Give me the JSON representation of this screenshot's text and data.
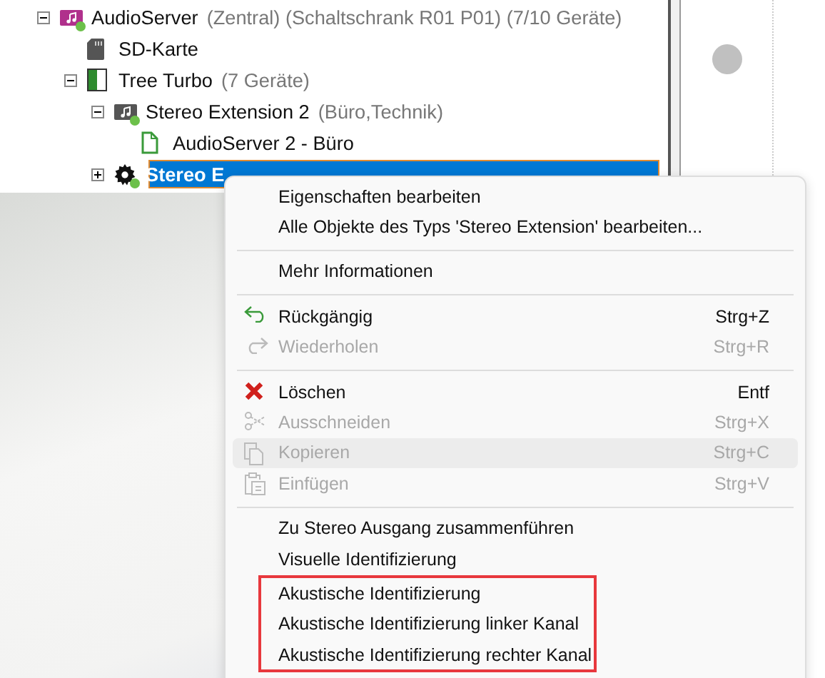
{
  "tree": [
    {
      "kind": "audioserver",
      "label": "AudioServer",
      "detail": "(Zentral) (Schaltschrank R01 P01)  (7/10 Geräte)",
      "expanded": true,
      "online": true,
      "selected": false,
      "children": [
        {
          "kind": "sdcard",
          "label": "SD-Karte",
          "online": false,
          "selected": false
        },
        {
          "kind": "treeturbo",
          "label": "Tree Turbo",
          "detail": "(7 Geräte)",
          "expanded": true,
          "online": false,
          "selected": false,
          "children": [
            {
              "kind": "extension",
              "label": "Stereo Extension 2",
              "detail": "(Büro,Technik)",
              "expanded": true,
              "online": true,
              "selected": false,
              "children": [
                {
                  "kind": "file",
                  "label": "AudioServer 2 - Büro",
                  "online": false,
                  "selected": false
                }
              ]
            },
            {
              "kind": "gear",
              "label": "Stereo E",
              "expanded": false,
              "online": true,
              "selected": true
            }
          ]
        }
      ]
    }
  ],
  "menu": [
    {
      "kind": "plain",
      "label": "Eigenschaften bearbeiten",
      "disabled": false,
      "hovered": false
    },
    {
      "kind": "plain",
      "label": "Alle Objekte des Typs 'Stereo Extension' bearbeiten...",
      "disabled": false,
      "hovered": false
    },
    {
      "kind": "separator"
    },
    {
      "kind": "plain",
      "label": "Mehr Informationen",
      "disabled": false,
      "hovered": false
    },
    {
      "kind": "separator"
    },
    {
      "kind": "undo",
      "label": "Rückgängig",
      "shortcut": "Strg+Z",
      "disabled": false,
      "hovered": false
    },
    {
      "kind": "redo",
      "label": "Wiederholen",
      "shortcut": "Strg+R",
      "disabled": true,
      "hovered": false
    },
    {
      "kind": "separator"
    },
    {
      "kind": "delete",
      "label": "Löschen",
      "shortcut": "Entf",
      "disabled": false,
      "hovered": false
    },
    {
      "kind": "cut",
      "label": "Ausschneiden",
      "shortcut": "Strg+X",
      "disabled": true,
      "hovered": false
    },
    {
      "kind": "copy",
      "label": "Kopieren",
      "shortcut": "Strg+C",
      "disabled": true,
      "hovered": true
    },
    {
      "kind": "paste",
      "label": "Einfügen",
      "shortcut": "Strg+V",
      "disabled": true,
      "hovered": false
    },
    {
      "kind": "separator"
    },
    {
      "kind": "plain",
      "label": "Zu Stereo Ausgang zusammenführen",
      "disabled": false,
      "hovered": false
    },
    {
      "kind": "plain",
      "label": "Visuelle Identifizierung",
      "disabled": false,
      "hovered": false
    },
    {
      "kind": "outlined",
      "items": [
        {
          "label": "Akustische Identifizierung",
          "disabled": false,
          "hovered": false
        },
        {
          "label": "Akustische Identifizierung linker Kanal",
          "disabled": false,
          "hovered": false
        },
        {
          "label": "Akustische Identifizierung rechter Kanal",
          "disabled": false,
          "hovered": false
        }
      ]
    }
  ]
}
